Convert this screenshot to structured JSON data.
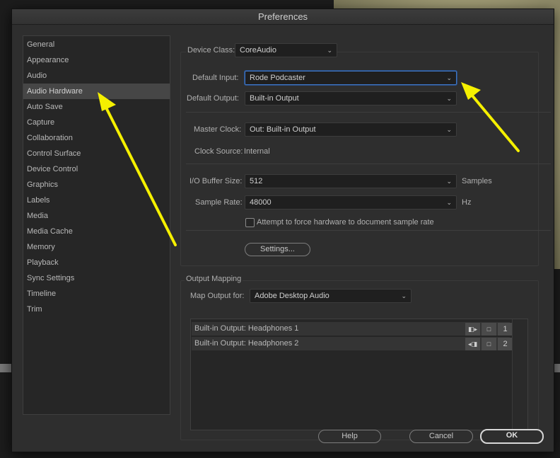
{
  "window": {
    "title": "Preferences"
  },
  "sidebar": {
    "items": [
      {
        "label": "General"
      },
      {
        "label": "Appearance"
      },
      {
        "label": "Audio"
      },
      {
        "label": "Audio Hardware",
        "selected": true
      },
      {
        "label": "Auto Save"
      },
      {
        "label": "Capture"
      },
      {
        "label": "Collaboration"
      },
      {
        "label": "Control Surface"
      },
      {
        "label": "Device Control"
      },
      {
        "label": "Graphics"
      },
      {
        "label": "Labels"
      },
      {
        "label": "Media"
      },
      {
        "label": "Media Cache"
      },
      {
        "label": "Memory"
      },
      {
        "label": "Playback"
      },
      {
        "label": "Sync Settings"
      },
      {
        "label": "Timeline"
      },
      {
        "label": "Trim"
      }
    ]
  },
  "hardware": {
    "device_class_label": "Device Class:",
    "device_class_value": "CoreAudio",
    "default_input_label": "Default Input:",
    "default_input_value": "Rode Podcaster",
    "default_output_label": "Default Output:",
    "default_output_value": "Built-in Output",
    "master_clock_label": "Master Clock:",
    "master_clock_value": "Out: Built-in Output",
    "clock_source_label": "Clock Source:",
    "clock_source_value": "Internal",
    "buffer_label": "I/O Buffer Size:",
    "buffer_value": "512",
    "buffer_unit": "Samples",
    "sample_rate_label": "Sample Rate:",
    "sample_rate_value": "48000",
    "sample_rate_unit": "Hz",
    "force_rate_label": "Attempt to force hardware to document sample rate",
    "force_rate_checked": false,
    "settings_button": "Settings..."
  },
  "output_mapping": {
    "legend": "Output Mapping",
    "map_for_label": "Map Output for:",
    "map_for_value": "Adobe Desktop Audio",
    "rows": [
      {
        "label": "Built-in Output: Headphones 1",
        "icon": "speaker-left-icon",
        "glyph": "◧▸",
        "channel": "1"
      },
      {
        "label": "Built-in Output: Headphones 2",
        "icon": "speaker-right-icon",
        "glyph": "◂◨",
        "channel": "2"
      }
    ]
  },
  "footer": {
    "help_button": "Help",
    "cancel_button": "Cancel",
    "ok_button": "OK"
  },
  "annotation": {
    "arrow_color": "#f5f000"
  }
}
